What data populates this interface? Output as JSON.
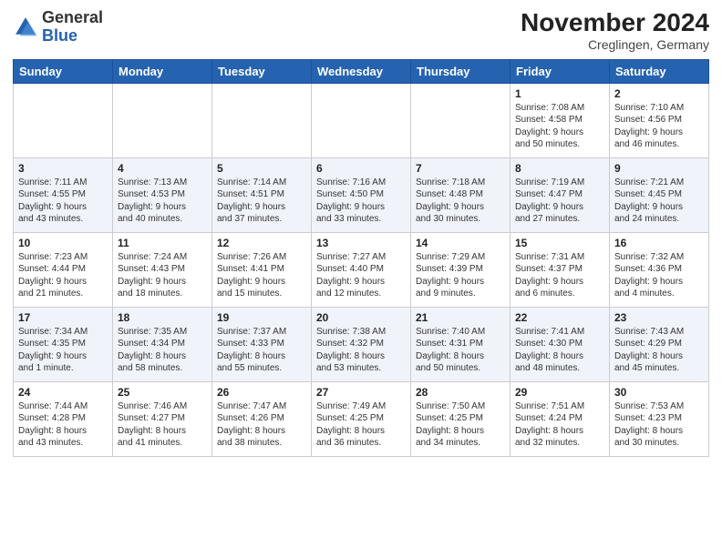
{
  "header": {
    "logo_general": "General",
    "logo_blue": "Blue",
    "month_title": "November 2024",
    "location": "Creglingen, Germany"
  },
  "weekdays": [
    "Sunday",
    "Monday",
    "Tuesday",
    "Wednesday",
    "Thursday",
    "Friday",
    "Saturday"
  ],
  "weeks": [
    [
      {
        "day": "",
        "text": ""
      },
      {
        "day": "",
        "text": ""
      },
      {
        "day": "",
        "text": ""
      },
      {
        "day": "",
        "text": ""
      },
      {
        "day": "",
        "text": ""
      },
      {
        "day": "1",
        "text": "Sunrise: 7:08 AM\nSunset: 4:58 PM\nDaylight: 9 hours\nand 50 minutes."
      },
      {
        "day": "2",
        "text": "Sunrise: 7:10 AM\nSunset: 4:56 PM\nDaylight: 9 hours\nand 46 minutes."
      }
    ],
    [
      {
        "day": "3",
        "text": "Sunrise: 7:11 AM\nSunset: 4:55 PM\nDaylight: 9 hours\nand 43 minutes."
      },
      {
        "day": "4",
        "text": "Sunrise: 7:13 AM\nSunset: 4:53 PM\nDaylight: 9 hours\nand 40 minutes."
      },
      {
        "day": "5",
        "text": "Sunrise: 7:14 AM\nSunset: 4:51 PM\nDaylight: 9 hours\nand 37 minutes."
      },
      {
        "day": "6",
        "text": "Sunrise: 7:16 AM\nSunset: 4:50 PM\nDaylight: 9 hours\nand 33 minutes."
      },
      {
        "day": "7",
        "text": "Sunrise: 7:18 AM\nSunset: 4:48 PM\nDaylight: 9 hours\nand 30 minutes."
      },
      {
        "day": "8",
        "text": "Sunrise: 7:19 AM\nSunset: 4:47 PM\nDaylight: 9 hours\nand 27 minutes."
      },
      {
        "day": "9",
        "text": "Sunrise: 7:21 AM\nSunset: 4:45 PM\nDaylight: 9 hours\nand 24 minutes."
      }
    ],
    [
      {
        "day": "10",
        "text": "Sunrise: 7:23 AM\nSunset: 4:44 PM\nDaylight: 9 hours\nand 21 minutes."
      },
      {
        "day": "11",
        "text": "Sunrise: 7:24 AM\nSunset: 4:43 PM\nDaylight: 9 hours\nand 18 minutes."
      },
      {
        "day": "12",
        "text": "Sunrise: 7:26 AM\nSunset: 4:41 PM\nDaylight: 9 hours\nand 15 minutes."
      },
      {
        "day": "13",
        "text": "Sunrise: 7:27 AM\nSunset: 4:40 PM\nDaylight: 9 hours\nand 12 minutes."
      },
      {
        "day": "14",
        "text": "Sunrise: 7:29 AM\nSunset: 4:39 PM\nDaylight: 9 hours\nand 9 minutes."
      },
      {
        "day": "15",
        "text": "Sunrise: 7:31 AM\nSunset: 4:37 PM\nDaylight: 9 hours\nand 6 minutes."
      },
      {
        "day": "16",
        "text": "Sunrise: 7:32 AM\nSunset: 4:36 PM\nDaylight: 9 hours\nand 4 minutes."
      }
    ],
    [
      {
        "day": "17",
        "text": "Sunrise: 7:34 AM\nSunset: 4:35 PM\nDaylight: 9 hours\nand 1 minute."
      },
      {
        "day": "18",
        "text": "Sunrise: 7:35 AM\nSunset: 4:34 PM\nDaylight: 8 hours\nand 58 minutes."
      },
      {
        "day": "19",
        "text": "Sunrise: 7:37 AM\nSunset: 4:33 PM\nDaylight: 8 hours\nand 55 minutes."
      },
      {
        "day": "20",
        "text": "Sunrise: 7:38 AM\nSunset: 4:32 PM\nDaylight: 8 hours\nand 53 minutes."
      },
      {
        "day": "21",
        "text": "Sunrise: 7:40 AM\nSunset: 4:31 PM\nDaylight: 8 hours\nand 50 minutes."
      },
      {
        "day": "22",
        "text": "Sunrise: 7:41 AM\nSunset: 4:30 PM\nDaylight: 8 hours\nand 48 minutes."
      },
      {
        "day": "23",
        "text": "Sunrise: 7:43 AM\nSunset: 4:29 PM\nDaylight: 8 hours\nand 45 minutes."
      }
    ],
    [
      {
        "day": "24",
        "text": "Sunrise: 7:44 AM\nSunset: 4:28 PM\nDaylight: 8 hours\nand 43 minutes."
      },
      {
        "day": "25",
        "text": "Sunrise: 7:46 AM\nSunset: 4:27 PM\nDaylight: 8 hours\nand 41 minutes."
      },
      {
        "day": "26",
        "text": "Sunrise: 7:47 AM\nSunset: 4:26 PM\nDaylight: 8 hours\nand 38 minutes."
      },
      {
        "day": "27",
        "text": "Sunrise: 7:49 AM\nSunset: 4:25 PM\nDaylight: 8 hours\nand 36 minutes."
      },
      {
        "day": "28",
        "text": "Sunrise: 7:50 AM\nSunset: 4:25 PM\nDaylight: 8 hours\nand 34 minutes."
      },
      {
        "day": "29",
        "text": "Sunrise: 7:51 AM\nSunset: 4:24 PM\nDaylight: 8 hours\nand 32 minutes."
      },
      {
        "day": "30",
        "text": "Sunrise: 7:53 AM\nSunset: 4:23 PM\nDaylight: 8 hours\nand 30 minutes."
      }
    ]
  ]
}
